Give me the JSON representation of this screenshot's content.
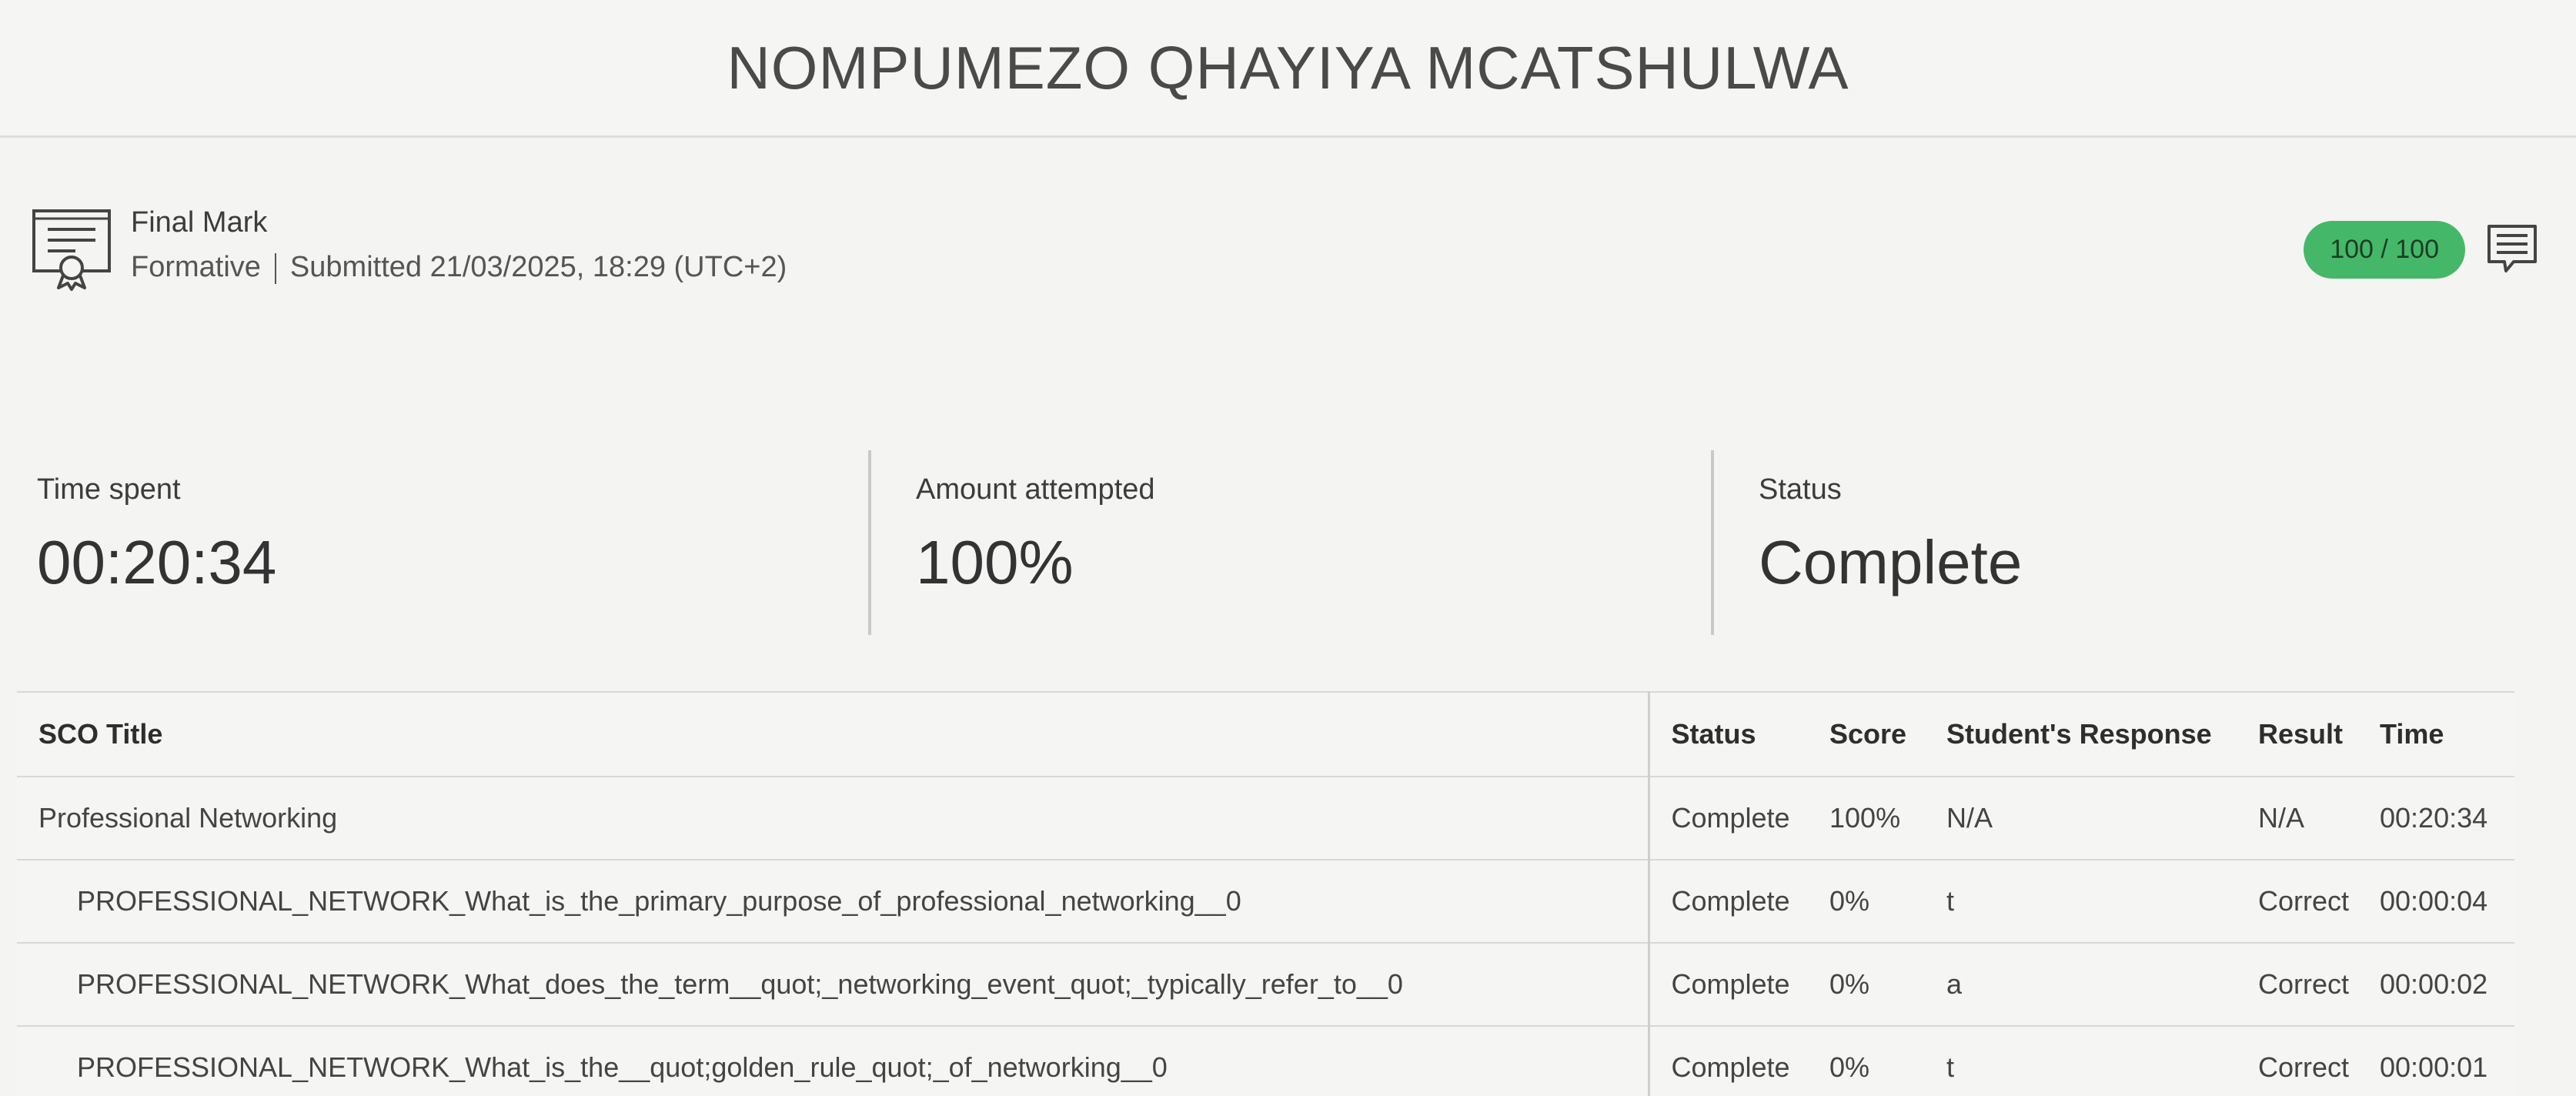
{
  "header": {
    "student_name": "NOMPUMEZO QHAYIYA MCATSHULWA"
  },
  "final_mark": {
    "title": "Final Mark",
    "type": "Formative",
    "submitted": "Submitted 21/03/2025, 18:29 (UTC+2)",
    "score": "100 / 100",
    "icon": "certificate-icon",
    "comment_icon": "comment-icon",
    "score_color": "#44b868"
  },
  "stats": {
    "time_spent_label": "Time spent",
    "time_spent_value": "00:20:34",
    "amount_attempted_label": "Amount attempted",
    "amount_attempted_value": "100%",
    "status_label": "Status",
    "status_value": "Complete"
  },
  "table": {
    "headers": {
      "title": "SCO Title",
      "status": "Status",
      "score": "Score",
      "response": "Student's Response",
      "result": "Result",
      "time": "Time"
    },
    "rows": [
      {
        "title": "Professional Networking",
        "status": "Complete",
        "score": "100%",
        "response": "N/A",
        "result": "N/A",
        "time": "00:20:34"
      },
      {
        "title": "PROFESSIONAL_NETWORK_What_is_the_primary_purpose_of_professional_networking__0",
        "status": "Complete",
        "score": "0%",
        "response": "t",
        "result": "Correct",
        "time": "00:00:04"
      },
      {
        "title": "PROFESSIONAL_NETWORK_What_does_the_term__quot;_networking_event_quot;_typically_refer_to__0",
        "status": "Complete",
        "score": "0%",
        "response": "a",
        "result": "Correct",
        "time": "00:00:02"
      },
      {
        "title": "PROFESSIONAL_NETWORK_What_is_the__quot;golden_rule_quot;_of_networking__0",
        "status": "Complete",
        "score": "0%",
        "response": "t",
        "result": "Correct",
        "time": "00:00:01"
      }
    ]
  }
}
